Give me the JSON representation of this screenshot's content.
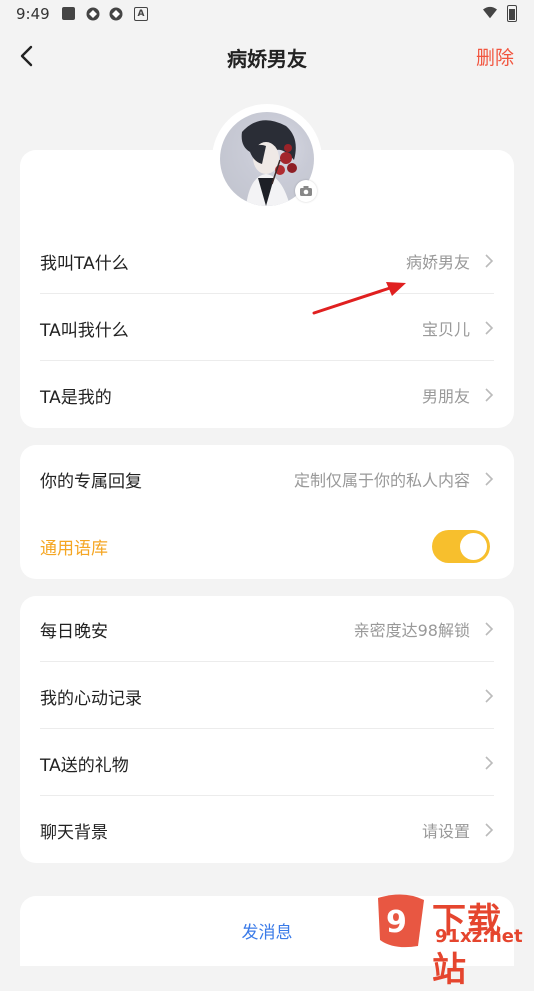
{
  "status_bar": {
    "time": "9:49",
    "a_icon": "A"
  },
  "header": {
    "title": "病娇男友",
    "delete_label": "删除"
  },
  "profile": {
    "rows": [
      {
        "label": "我叫TA什么",
        "value": "病娇男友"
      },
      {
        "label": "TA叫我什么",
        "value": "宝贝儿"
      },
      {
        "label": "TA是我的",
        "value": "男朋友"
      }
    ]
  },
  "replies": {
    "exclusive": {
      "label": "你的专属回复",
      "value": "定制仅属于你的私人内容"
    },
    "corpus": {
      "label": "通用语库",
      "enabled": true
    }
  },
  "extras": {
    "rows": [
      {
        "label": "每日晚安",
        "value": "亲密度达98解锁"
      },
      {
        "label": "我的心动记录",
        "value": ""
      },
      {
        "label": "TA送的礼物",
        "value": ""
      },
      {
        "label": "聊天背景",
        "value": "请设置"
      }
    ]
  },
  "footer": {
    "send_label": "发消息"
  },
  "watermark": {
    "text": "下载站",
    "sub": "91xz.net"
  },
  "colors": {
    "accent_orange": "#f5a623",
    "delete_red": "#f2553f",
    "toggle_on": "#f7bf2d",
    "link_blue": "#3b7be8",
    "annotation_arrow": "#e02020"
  }
}
